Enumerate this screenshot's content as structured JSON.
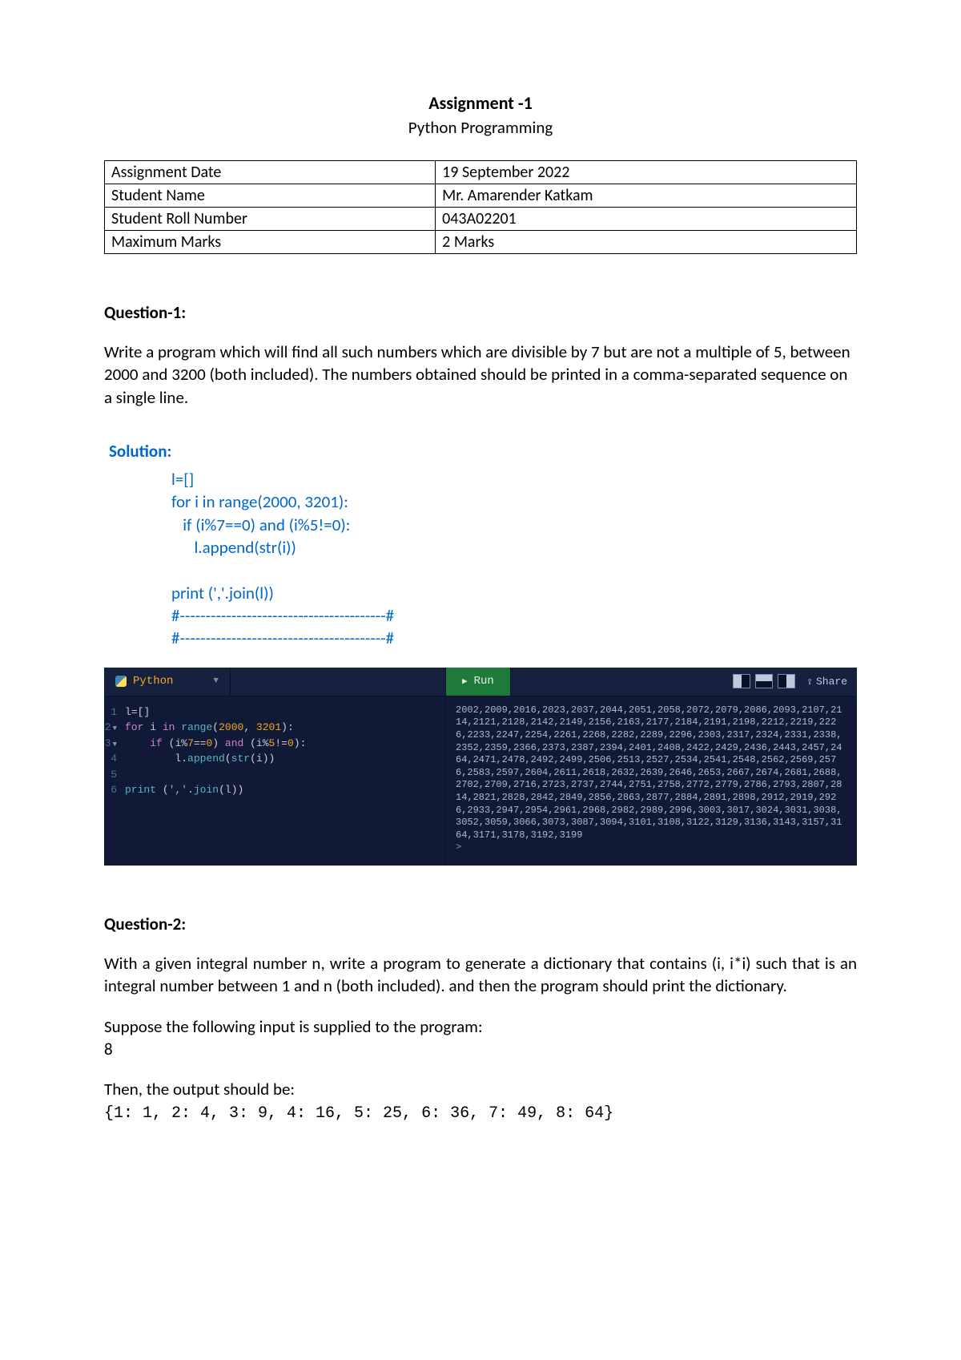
{
  "title": "Assignment -1",
  "subtitle": "Python Programming",
  "meta": {
    "rows": [
      {
        "label": "Assignment Date",
        "value": "19 September 2022"
      },
      {
        "label": "Student Name",
        "value": "Mr. Amarender Katkam"
      },
      {
        "label": "Student Roll Number",
        "value": "043A02201"
      },
      {
        "label": "Maximum Marks",
        "value": "2 Marks"
      }
    ]
  },
  "q1": {
    "heading": "Question-1:",
    "text": "Write a program which will find all such numbers which are divisible by 7 but are not a multiple of 5, between 2000 and 3200 (both included). The numbers obtained should be printed in a comma-separated sequence on a single line.",
    "solution_label": "Solution:",
    "code": "l=[]\nfor i in range(2000, 3201):\n   if (i%7==0) and (i%5!=0):\n      l.append(str(i))\n\nprint (','.join(l))\n#----------------------------------------#\n#----------------------------------------#"
  },
  "editor": {
    "language": "Python",
    "run_label": "Run",
    "share_label": "Share",
    "code_lines": [
      {
        "n": "1",
        "tri": false,
        "html": "<span class='id'>l</span>=[]"
      },
      {
        "n": "2",
        "tri": true,
        "html": "<span class='kw'>for</span> <span class='id'>i</span> <span class='kw'>in</span> <span class='fn'>range</span>(<span class='num'>2000</span>, <span class='num'>3201</span>):"
      },
      {
        "n": "3",
        "tri": true,
        "html": "    <span class='kw'>if</span> (<span class='id'>i</span>%<span class='num'>7</span>==<span class='num'>0</span>) <span class='kw'>and</span> (<span class='id'>i</span>%<span class='num'>5</span>!=<span class='num'>0</span>):"
      },
      {
        "n": "4",
        "tri": false,
        "html": "        <span class='id'>l</span>.<span class='fn'>append</span>(<span class='fn'>str</span>(<span class='id'>i</span>))"
      },
      {
        "n": "5",
        "tri": false,
        "html": ""
      },
      {
        "n": "6",
        "tri": false,
        "html": "<span class='fn'>print</span> (<span class='str'>','</span>.<span class='fn'>join</span>(<span class='id'>l</span>))"
      }
    ],
    "output": "2002,2009,2016,2023,2037,2044,2051,2058,2072,2079,2086,2093,2107,2114,2121,2128,2142,2149,2156,2163,2177,2184,2191,2198,2212,2219,2226,2233,2247,2254,2261,2268,2282,2289,2296,2303,2317,2324,2331,2338,2352,2359,2366,2373,2387,2394,2401,2408,2422,2429,2436,2443,2457,2464,2471,2478,2492,2499,2506,2513,2527,2534,2541,2548,2562,2569,2576,2583,2597,2604,2611,2618,2632,2639,2646,2653,2667,2674,2681,2688,2702,2709,2716,2723,2737,2744,2751,2758,2772,2779,2786,2793,2807,2814,2821,2828,2842,2849,2856,2863,2877,2884,2891,2898,2912,2919,2926,2933,2947,2954,2961,2968,2982,2989,2996,3003,3017,3024,3031,3038,3052,3059,3066,3073,3087,3094,3101,3108,3122,3129,3136,3143,3157,3164,3171,3178,3192,3199",
    "prompt": ">"
  },
  "q2": {
    "heading": "Question-2:",
    "text": "With a given integral number n, write a program to generate a dictionary that contains (i, i*i) such that is an integral number between 1 and n (both included). and then the program should print the dictionary.",
    "input_label": "Suppose the following input is supplied to the program:",
    "input_value": "8",
    "output_label": "Then, the output should be:",
    "output_value": "{1: 1, 2: 4, 3: 9, 4: 16, 5: 25, 6: 36, 7: 49, 8: 64}"
  }
}
